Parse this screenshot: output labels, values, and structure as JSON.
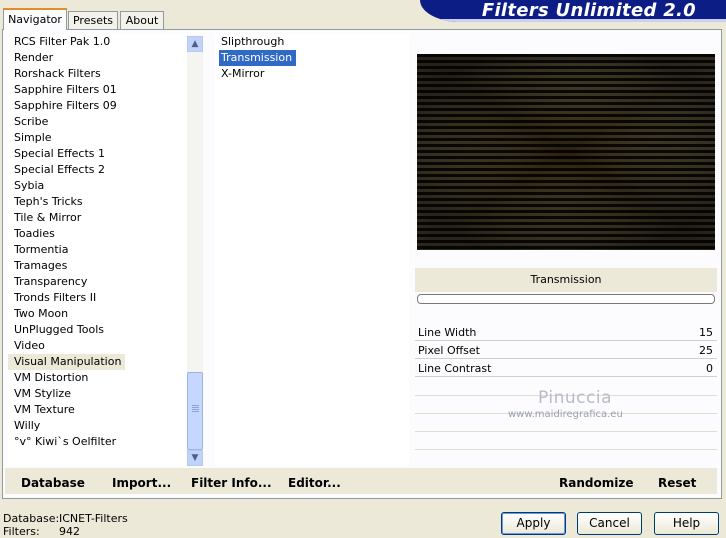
{
  "banner": {
    "title": "Filters Unlimited 2.0"
  },
  "tabs": [
    {
      "label": "Navigator",
      "active": true
    },
    {
      "label": "Presets",
      "active": false
    },
    {
      "label": "About",
      "active": false
    }
  ],
  "categories": [
    "RCS Filter Pak 1.0",
    "Render",
    "Rorshack Filters",
    "Sapphire Filters 01",
    "Sapphire Filters 09",
    "Scribe",
    "Simple",
    "Special Effects 1",
    "Special Effects 2",
    "Sybia",
    "Teph's Tricks",
    "Tile & Mirror",
    "Toadies",
    "Tormentia",
    "Tramages",
    "Transparency",
    "Tronds Filters II",
    "Two Moon",
    "UnPlugged Tools",
    "Video",
    "Visual Manipulation",
    "VM Distortion",
    "VM Stylize",
    "VM Texture",
    "Willy",
    "°v° Kiwi`s Oelfilter"
  ],
  "selected_category": "Visual Manipulation",
  "filters": [
    "Slipthrough",
    "Transmission",
    "X-Mirror"
  ],
  "selected_filter": "Transmission",
  "params_panel": {
    "filter_name": "Transmission",
    "sliders": [
      {
        "label": "Line Width",
        "value": "15"
      },
      {
        "label": "Pixel Offset",
        "value": "25"
      },
      {
        "label": "Line Contrast",
        "value": "0"
      }
    ]
  },
  "watermark": {
    "name": "Pinuccia",
    "url": "www.maidiregrafica.eu"
  },
  "bottom_links": {
    "database": "Database",
    "import": "Import...",
    "filter_info": "Filter Info...",
    "editor": "Editor...",
    "randomize": "Randomize",
    "reset": "Reset"
  },
  "status": {
    "database_label": "Database:",
    "database_value": "ICNET-Filters",
    "filters_label": "Filters:",
    "filters_value": "942"
  },
  "buttons": {
    "apply": "Apply",
    "cancel": "Cancel",
    "help": "Help"
  },
  "colors": {
    "accent_tab": "#e68b2c",
    "selection": "#316ac5",
    "banner": "#0c1e85",
    "preview_gold": "#d8c88c"
  },
  "icons": {
    "scroll_up": "scroll-up-icon",
    "scroll_down": "scroll-down-icon"
  }
}
